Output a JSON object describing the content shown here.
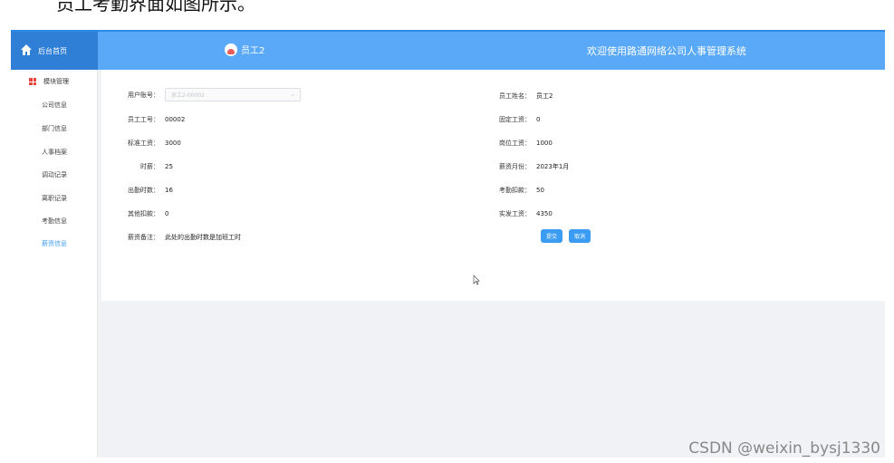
{
  "doc_text": "员工考勤界面如图所示。",
  "header": {
    "home_label": "后台首页",
    "user_name": "员工2",
    "system_title": "欢迎使用路通网络公司人事管理系统"
  },
  "sidebar": {
    "group_label": "模块管理",
    "items": [
      {
        "label": "公司信息"
      },
      {
        "label": "部门信息"
      },
      {
        "label": "人事档案"
      },
      {
        "label": "调动记录"
      },
      {
        "label": "离职记录"
      },
      {
        "label": "考勤信息"
      },
      {
        "label": "薪资信息",
        "active": true
      }
    ]
  },
  "form": {
    "user_account": {
      "label": "用户账号：",
      "placeholder": "员工2-00002"
    },
    "employee_no": {
      "label": "员工工号：",
      "value": "00002"
    },
    "standard_salary": {
      "label": "标准工资：",
      "value": "3000"
    },
    "hourly_pay": {
      "label": "时薪：",
      "value": "25"
    },
    "attendance_hours": {
      "label": "出勤时数：",
      "value": "16"
    },
    "other_deduction": {
      "label": "其他扣款：",
      "value": "0"
    },
    "salary_note": {
      "label": "薪资备注：",
      "value": "此处的出勤时数是加班工时"
    },
    "employee_name": {
      "label": "员工姓名：",
      "value": "员工2"
    },
    "fixed_salary": {
      "label": "固定工资：",
      "value": "0"
    },
    "post_salary": {
      "label": "岗位工资：",
      "value": "1000"
    },
    "salary_month": {
      "label": "薪资月份：",
      "value": "2023年1月"
    },
    "attendance_deduction": {
      "label": "考勤扣款：",
      "value": "50"
    },
    "actual_salary": {
      "label": "实发工资：",
      "value": "4350"
    },
    "submit_label": "提交",
    "cancel_label": "取消"
  },
  "watermark": "CSDN @weixin_bysj1330",
  "colors": {
    "topbar": "#5aa9f8",
    "home_block": "#2f7fd6",
    "accent": "#3c9cf2",
    "background": "#f1f2f5"
  }
}
